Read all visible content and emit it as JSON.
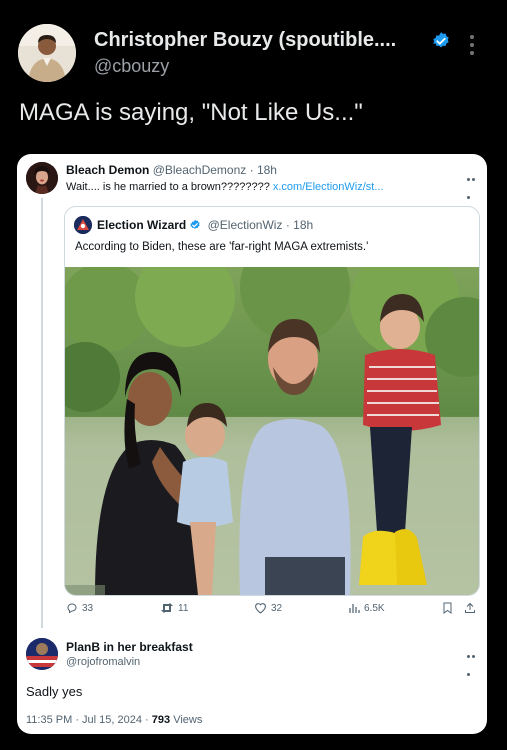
{
  "main_tweet": {
    "author_name": "Christopher Bouzy (spoutible....",
    "author_handle": "@cbouzy",
    "text": "MAGA is saying, \"Not Like Us...\""
  },
  "embedded": {
    "reply_tweet": {
      "author_name": "Bleach Demon",
      "author_handle": "@BleachDemonz",
      "time": "· 18h",
      "text": "Wait.... is he married to a brown????????",
      "link": "x.com/ElectionWiz/st..."
    },
    "quoted_tweet": {
      "author_name": "Election Wizard",
      "author_handle": "@ElectionWiz",
      "time": "· 18h",
      "text": "According to Biden, these are 'far-right MAGA extremists.'"
    },
    "actions": {
      "replies": "33",
      "reposts": "11",
      "likes": "32",
      "views": "6.5K"
    },
    "final_reply": {
      "author_name": "PlanB in her breakfast",
      "author_handle": "@rojofromalvin",
      "text": "Sadly yes",
      "timestamp": "11:35 PM · Jul 15, 2024 ·",
      "views_count": "793",
      "views_label": "Views"
    }
  },
  "colors": {
    "background": "#000000",
    "card": "#ffffff",
    "verified_blue": "#1d9bf0",
    "link_blue": "#1d9bf0",
    "secondary_text": "#536471"
  }
}
